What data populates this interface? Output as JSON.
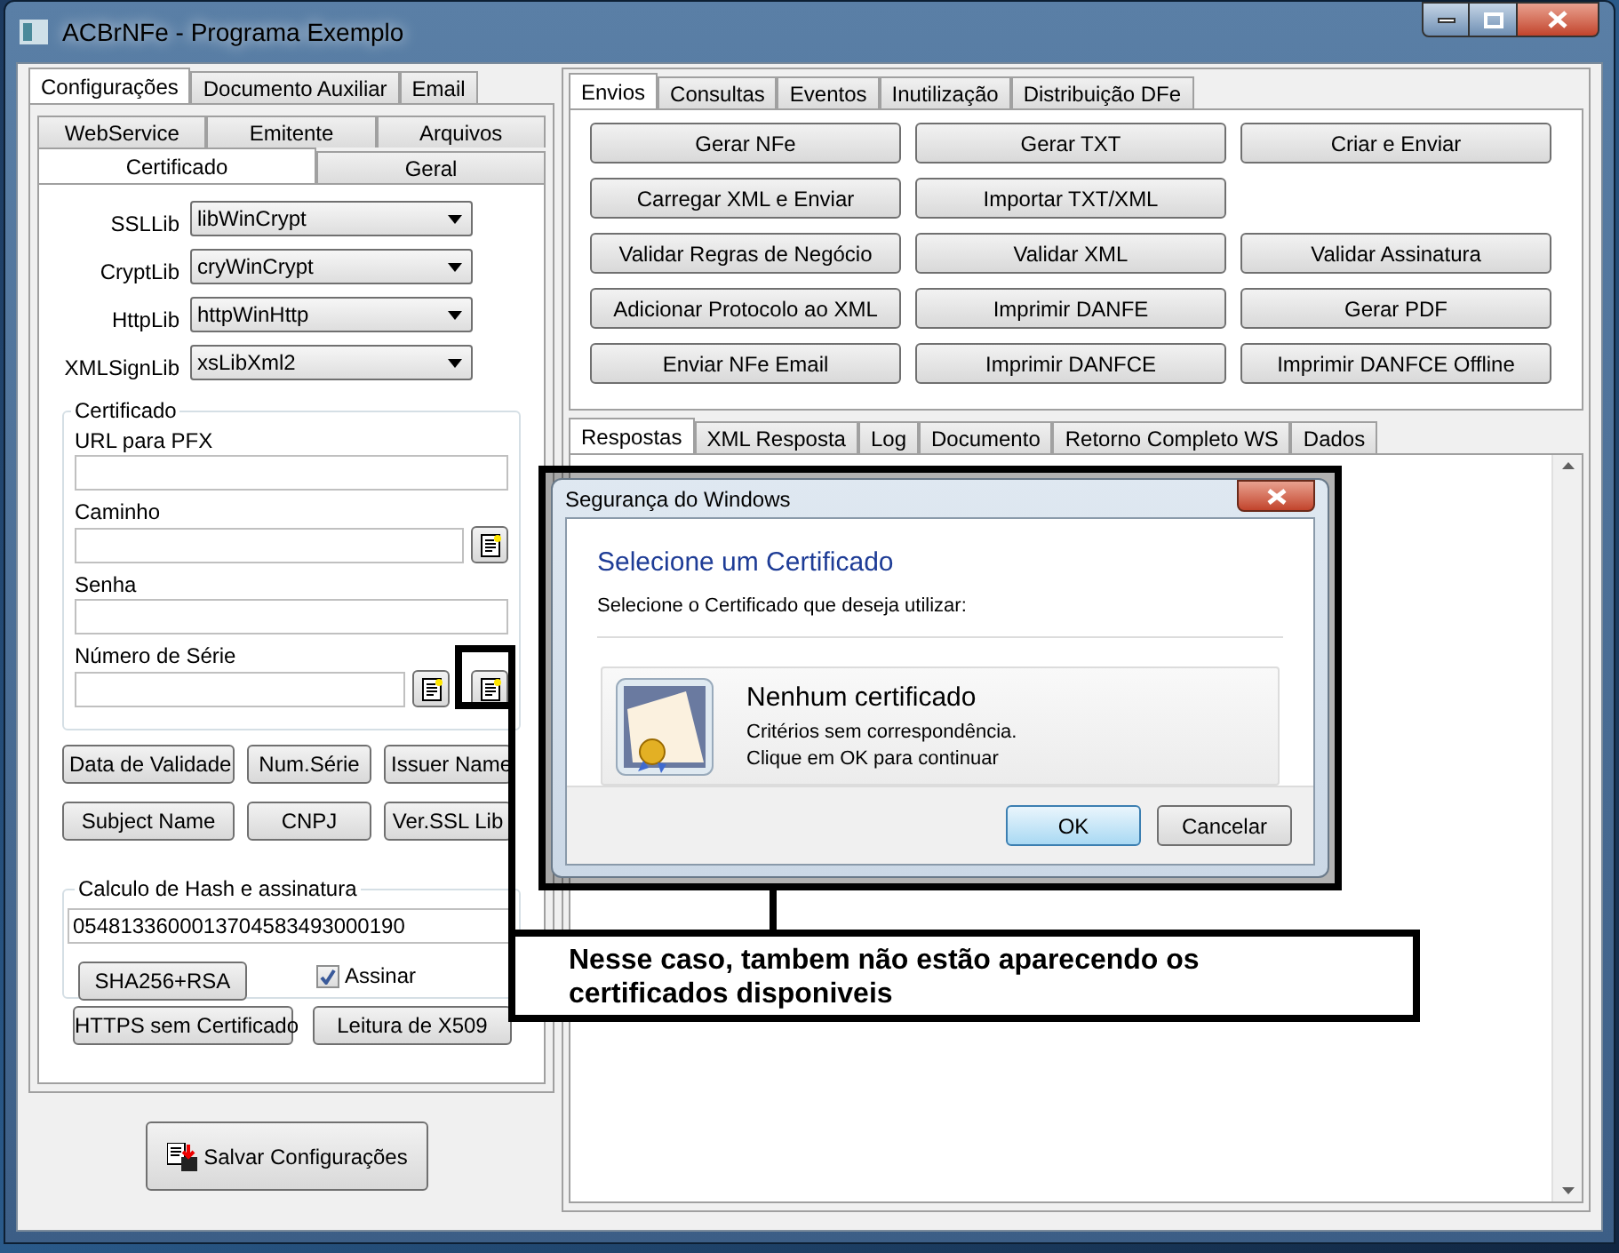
{
  "window": {
    "title": "ACBrNFe - Programa Exemplo"
  },
  "left": {
    "tabs": [
      {
        "label": "Configurações",
        "selected": true
      },
      {
        "label": "Documento Auxiliar",
        "selected": false
      },
      {
        "label": "Email",
        "selected": false
      }
    ],
    "subtabs_back": [
      {
        "label": "WebService",
        "selected": false
      },
      {
        "label": "Emitente",
        "selected": false
      },
      {
        "label": "Arquivos",
        "selected": false
      }
    ],
    "subtabs_front": [
      {
        "label": "Certificado",
        "selected": true
      },
      {
        "label": "Geral",
        "selected": false
      }
    ],
    "combos": [
      {
        "label": "SSLLib",
        "value": "libWinCrypt"
      },
      {
        "label": "CryptLib",
        "value": "cryWinCrypt"
      },
      {
        "label": "HttpLib",
        "value": "httpWinHttp"
      },
      {
        "label": "XMLSignLib",
        "value": "xsLibXml2"
      }
    ],
    "certificado": {
      "title": "Certificado",
      "fields": [
        {
          "label": "URL para PFX",
          "kind": "plain"
        },
        {
          "label": "Caminho",
          "kind": "browse"
        },
        {
          "label": "Senha",
          "kind": "plain"
        },
        {
          "label": "Número de Série",
          "kind": "browse2"
        }
      ]
    },
    "buttons": [
      [
        "Data de Validade",
        "Num.Série",
        "Issuer Name"
      ],
      [
        "Subject Name",
        "CNPJ",
        "Ver.SSL Lib"
      ]
    ],
    "hash": {
      "title": "Calculo de Hash e assinatura",
      "value": "0548133600013704583493000190",
      "button": "SHA256+RSA",
      "checkbox": {
        "label": "Assinar",
        "checked": true
      }
    },
    "bottom_buttons": [
      "HTTPS sem Certificado",
      "Leitura de X509"
    ],
    "save_button": "Salvar Configurações"
  },
  "right": {
    "tabs": [
      {
        "label": "Envios",
        "selected": true
      },
      {
        "label": "Consultas",
        "selected": false
      },
      {
        "label": "Eventos",
        "selected": false
      },
      {
        "label": "Inutilização",
        "selected": false
      },
      {
        "label": "Distribuição DFe",
        "selected": false
      }
    ],
    "actions": [
      [
        "Gerar NFe",
        "Gerar TXT",
        "Criar e Enviar"
      ],
      [
        "Carregar XML e Enviar",
        "Importar TXT/XML"
      ],
      [
        "Validar Regras de Negócio",
        "Validar XML",
        "Validar Assinatura"
      ],
      [
        "Adicionar Protocolo ao XML",
        "Imprimir DANFE",
        "Gerar PDF"
      ],
      [
        "Enviar NFe Email",
        "Imprimir DANFCE",
        "Imprimir DANFCE Offline"
      ]
    ],
    "lower_tabs": [
      {
        "label": "Respostas",
        "selected": true
      },
      {
        "label": "XML Resposta",
        "selected": false
      },
      {
        "label": "Log",
        "selected": false
      },
      {
        "label": "Documento",
        "selected": false
      },
      {
        "label": "Retorno Completo WS",
        "selected": false
      },
      {
        "label": "Dados",
        "selected": false
      }
    ]
  },
  "dialog": {
    "title": "Segurança do Windows",
    "heading": "Selecione um Certificado",
    "subheading": "Selecione o Certificado que deseja utilizar:",
    "item_title": "Nenhum certificado",
    "item_lines": [
      "Critérios sem correspondência.",
      "Clique em OK para continuar"
    ],
    "buttons": [
      {
        "label": "OK",
        "default": true
      },
      {
        "label": "Cancelar",
        "default": false
      }
    ]
  },
  "annotation": "Nesse caso, tambem não estão aparecendo os certificados disponiveis"
}
